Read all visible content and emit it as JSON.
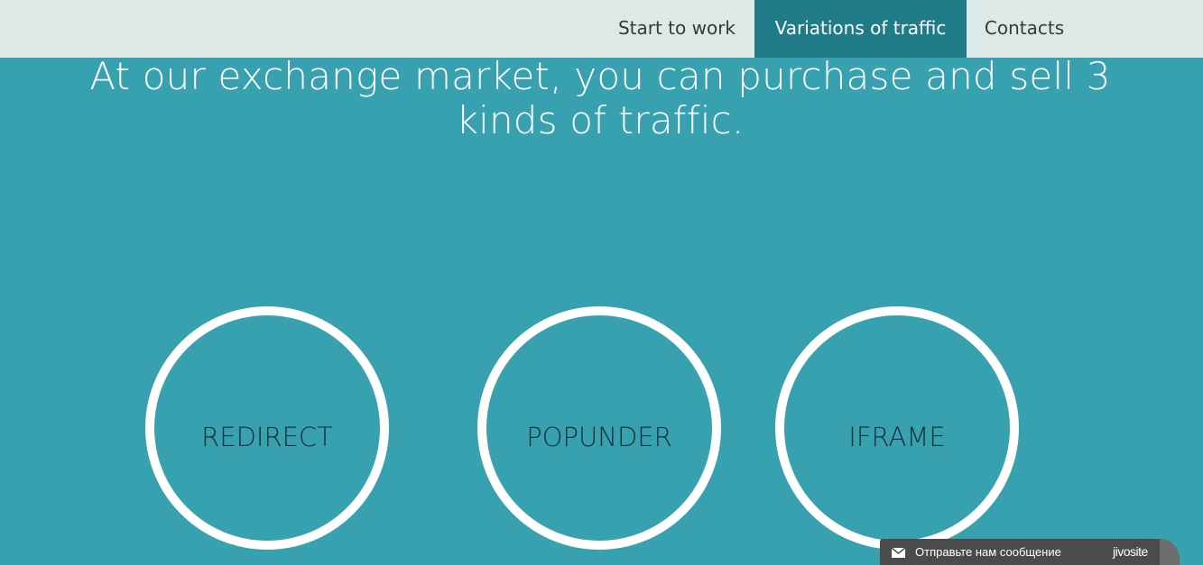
{
  "nav": {
    "items": [
      {
        "label": "Start to work"
      },
      {
        "label": "Variations of traffic",
        "active": true
      },
      {
        "label": "Contacts"
      }
    ]
  },
  "headline": "At our exchange market, you can purchase and sell 3 kinds of traffic.",
  "traffic_types": [
    {
      "label": "REDIRECT"
    },
    {
      "label": "POPUNDER"
    },
    {
      "label": "IFRAME"
    }
  ],
  "chat_widget": {
    "text": "Отправьте нам сообщение",
    "brand": "jivosite",
    "icon": "mail-icon"
  },
  "colors": {
    "background": "#38a1b0",
    "nav_background": "#dde9e7",
    "nav_active": "#1f7b88",
    "circle_border": "#ffffff"
  }
}
